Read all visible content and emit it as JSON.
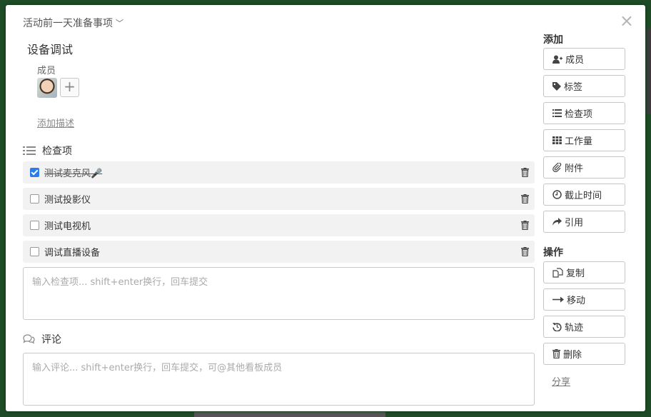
{
  "board": {
    "name": "活动前一天准备事项"
  },
  "card": {
    "title": "设备调试",
    "members_label": "成员",
    "add_desc": "添加描述"
  },
  "checklist": {
    "title": "检查项",
    "items": [
      {
        "text": "测试麦克风🎤",
        "checked": true
      },
      {
        "text": "测试投影仪",
        "checked": false
      },
      {
        "text": "测试电视机",
        "checked": false
      },
      {
        "text": "调试直播设备",
        "checked": false
      }
    ],
    "input_placeholder": "输入检查项... shift+enter换行，回车提交"
  },
  "comments": {
    "title": "评论",
    "input_placeholder": "输入评论... shift+enter换行，回车提交，可@其他看板成员"
  },
  "sidebar": {
    "add_title": "添加",
    "add_buttons": [
      {
        "label": "成员",
        "icon": "add-user-icon"
      },
      {
        "label": "标签",
        "icon": "tag-icon"
      },
      {
        "label": "检查项",
        "icon": "list-icon"
      },
      {
        "label": "工作量",
        "icon": "grid-icon"
      },
      {
        "label": "附件",
        "icon": "paperclip-icon"
      },
      {
        "label": "截止时间",
        "icon": "clock-icon"
      },
      {
        "label": "引用",
        "icon": "share-arrow-icon"
      }
    ],
    "actions_title": "操作",
    "action_buttons": [
      {
        "label": "复制",
        "icon": "copy-icon"
      },
      {
        "label": "移动",
        "icon": "arrow-right-icon"
      },
      {
        "label": "轨迹",
        "icon": "history-icon"
      },
      {
        "label": "删除",
        "icon": "trash-icon"
      }
    ],
    "share_label": "分享"
  },
  "colors": {
    "accent": "#2b7de9",
    "backdrop": "#1e4b26"
  }
}
